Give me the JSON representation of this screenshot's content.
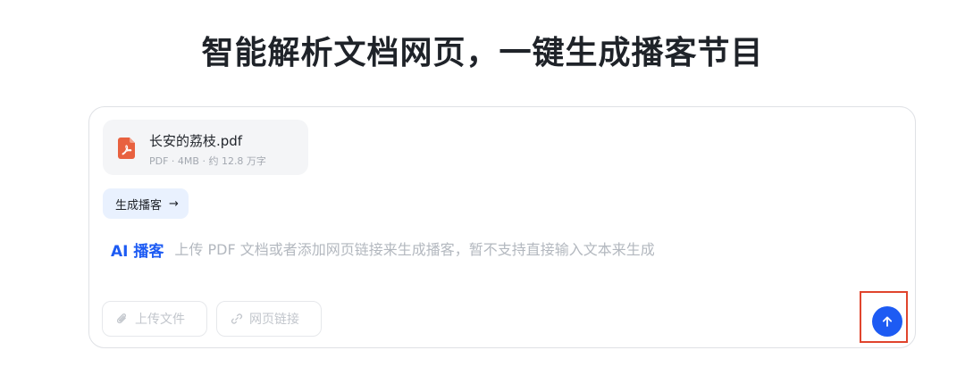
{
  "headline": "智能解析文档网页，一键生成播客节目",
  "file": {
    "name": "长安的荔枝.pdf",
    "meta": "PDF · 4MB · 约 12.8 万字",
    "icon": "pdf-file-icon",
    "icon_color": "#e8613f"
  },
  "generate_chip": {
    "label": "生成播客",
    "arrow": "→"
  },
  "prompt": {
    "tag": "AI 播客",
    "placeholder": "上传 PDF 文档或者添加网页链接来生成播客，暂不支持直接输入文本来生成",
    "value": ""
  },
  "toolbar": {
    "upload_label": "上传文件",
    "link_label": "网页链接",
    "upload_icon": "paperclip-icon",
    "link_icon": "link-icon"
  },
  "send": {
    "icon": "arrow-up-icon",
    "color": "#1d5bf3",
    "highlight_color": "#e0442d"
  }
}
